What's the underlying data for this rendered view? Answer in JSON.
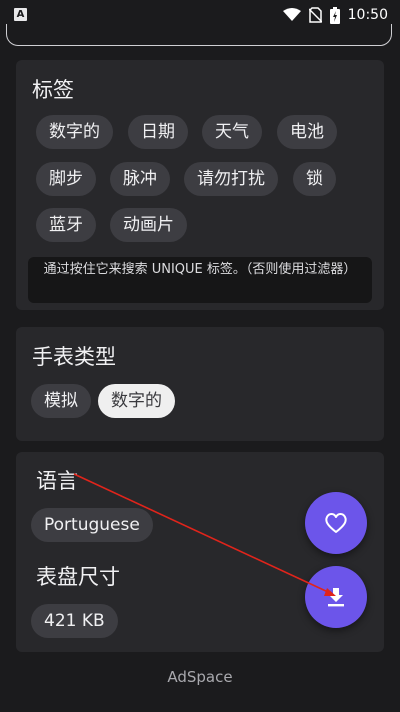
{
  "status_bar": {
    "app_icon": "A",
    "time": "10:50",
    "icons": [
      "wifi-icon",
      "no-sim-icon",
      "battery-charging-icon"
    ]
  },
  "tags_card": {
    "title": "标签",
    "chips": [
      "数字的",
      "日期",
      "天气",
      "电池",
      "脚步",
      "脉冲",
      "请勿打扰",
      "锁",
      "蓝牙",
      "动画片"
    ],
    "note": "通过按住它来搜索 UNIQUE 标签。（否则使用过滤器）"
  },
  "watch_type_card": {
    "title": "手表类型",
    "options": [
      "模拟",
      "数字的"
    ],
    "selected": "数字的"
  },
  "info_card": {
    "language_title": "语言",
    "language_value": "Portuguese",
    "size_title": "表盘尺寸",
    "size_value": "421 KB"
  },
  "fabs": {
    "favorite_icon": "heart-outline-icon",
    "download_icon": "download-icon",
    "color": "#6c55ea"
  },
  "footer": {
    "ad_label": "AdSpace"
  },
  "colors": {
    "background": "#1b1b1d",
    "card": "#28282b",
    "chip": "#3d3d42",
    "annotation": "#e0241b"
  }
}
